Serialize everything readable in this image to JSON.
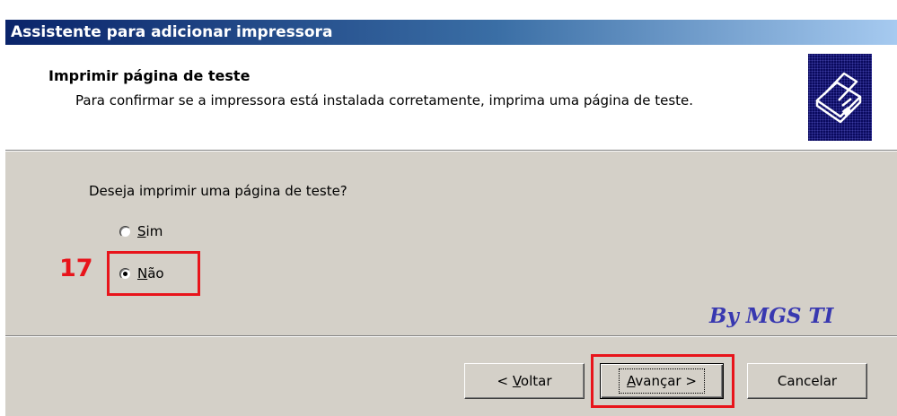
{
  "window": {
    "title": "Assistente para adicionar impressora"
  },
  "header": {
    "title": "Imprimir página de teste",
    "description": "Para confirmar se a impressora está instalada corretamente, imprima uma página de teste.",
    "icon": "printer-icon"
  },
  "content": {
    "question": "Deseja imprimir uma página de teste?",
    "options": [
      {
        "accel": "S",
        "rest": "im",
        "checked": false
      },
      {
        "accel": "N",
        "rest": "ão",
        "checked": true
      }
    ],
    "annotation_step": "17",
    "watermark": "By MGS TI"
  },
  "buttons": {
    "back": {
      "prefix": "< ",
      "accel": "V",
      "rest": "oltar"
    },
    "next": {
      "accel": "A",
      "rest": "vançar >"
    },
    "cancel": "Cancelar"
  },
  "colors": {
    "highlight": "#e8141b",
    "titlebar_start": "#0a246a",
    "titlebar_end": "#a6caf0",
    "dialog_bg": "#d4d0c8",
    "watermark": "#3838b0"
  }
}
